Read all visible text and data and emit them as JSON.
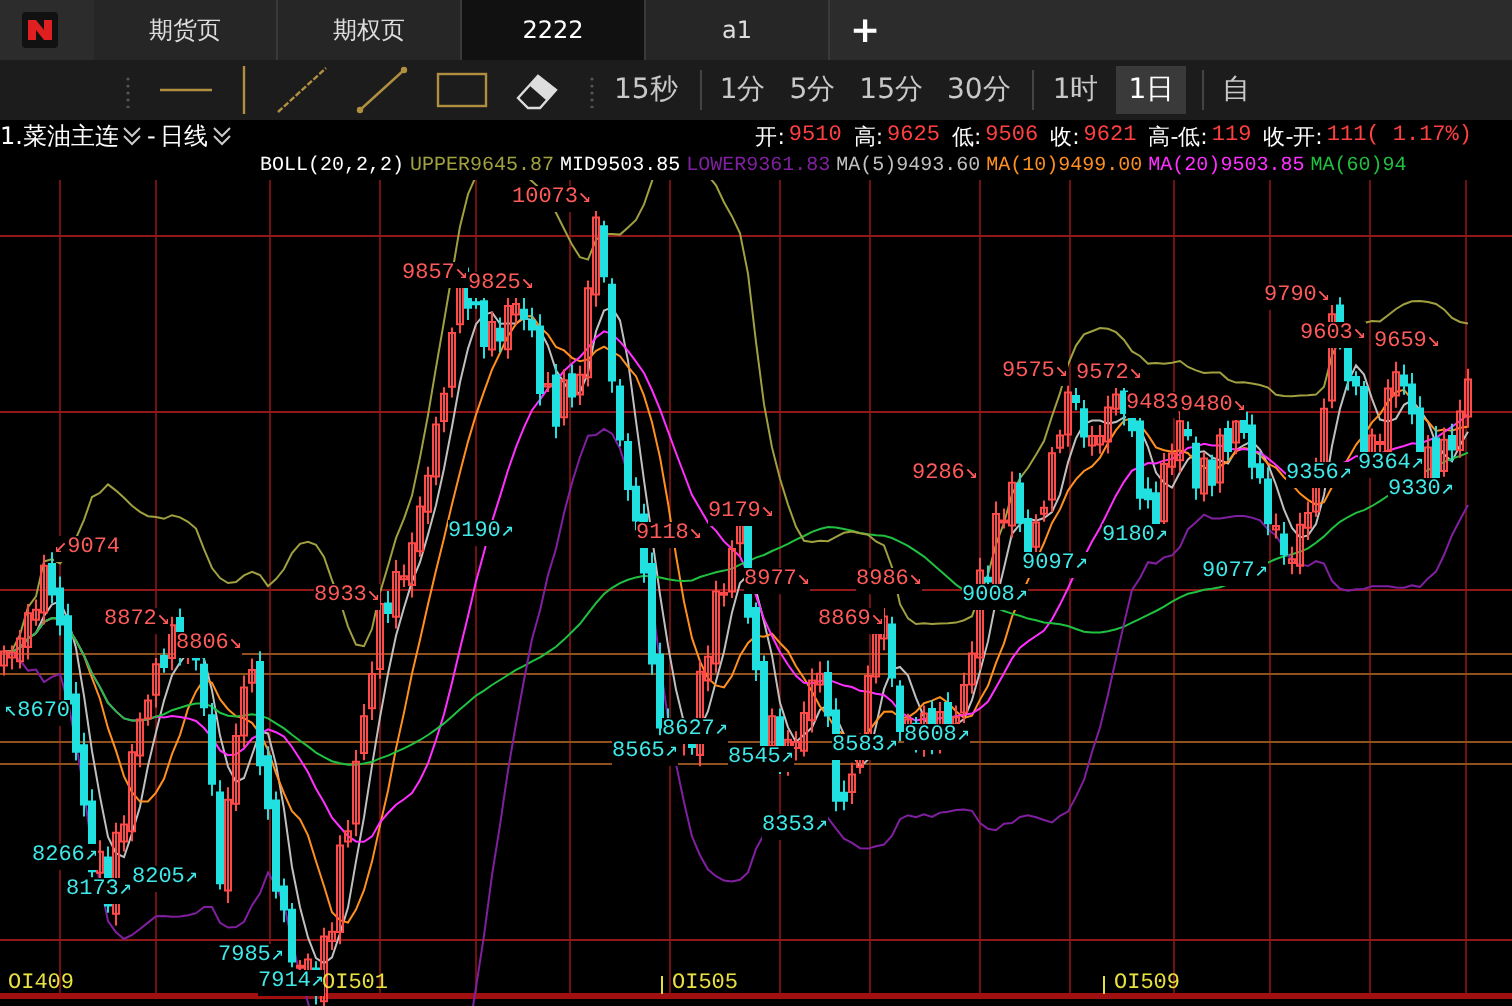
{
  "tabs": [
    {
      "label": "期货页",
      "selected": false
    },
    {
      "label": "期权页",
      "selected": false
    },
    {
      "label": "2222",
      "selected": true
    },
    {
      "label": "a1",
      "selected": false
    }
  ],
  "add_tab": "+",
  "periods": [
    {
      "label": "15秒",
      "selected": false
    },
    {
      "label": "1分",
      "selected": false
    },
    {
      "label": "5分",
      "selected": false
    },
    {
      "label": "15分",
      "selected": false
    },
    {
      "label": "30分",
      "selected": false
    },
    {
      "label": "1时",
      "selected": false
    },
    {
      "label": "1日",
      "selected": true
    },
    {
      "label": "自",
      "selected": false
    }
  ],
  "quote": {
    "symbol": "1.菜油主连",
    "separator": "-",
    "period": "日线",
    "fields": [
      {
        "label": "开:",
        "value": "9510"
      },
      {
        "label": "高:",
        "value": "9625"
      },
      {
        "label": "低:",
        "value": "9506"
      },
      {
        "label": "收:",
        "value": "9621"
      },
      {
        "label": "高-低:",
        "value": "119"
      },
      {
        "label": "收-开:",
        "value": "111( 1.17%)"
      }
    ]
  },
  "indicators": [
    {
      "label": "BOLL(20,2,2)",
      "color": "#ffffff"
    },
    {
      "label": "UPPER",
      "value": "9645.87",
      "color": "#a0a040"
    },
    {
      "label": "MID",
      "value": "9503.85",
      "color": "#ffffff"
    },
    {
      "label": "LOWER",
      "value": "9361.83",
      "color": "#8020a0"
    },
    {
      "label": "MA(5)",
      "value": "9493.60",
      "color": "#c0c0c0"
    },
    {
      "label": "MA(10)",
      "value": "9499.00",
      "color": "#ff9020"
    },
    {
      "label": "MA(20)",
      "value": "9503.85",
      "color": "#ff30ff"
    },
    {
      "label": "MA(60)",
      "value": "94",
      "color": "#20c040"
    }
  ],
  "chart": {
    "annotations": [
      {
        "text": "10073↘",
        "kind": "high"
      },
      {
        "text": "9857↘",
        "kind": "high"
      },
      {
        "text": "9825↘",
        "kind": "high"
      },
      {
        "text": "↙9074",
        "kind": "high"
      },
      {
        "text": "8872↘",
        "kind": "high"
      },
      {
        "text": "8806↘",
        "kind": "high"
      },
      {
        "text": "8933↘",
        "kind": "high"
      },
      {
        "text": "9190↗",
        "kind": "low"
      },
      {
        "text": "9118↘",
        "kind": "high"
      },
      {
        "text": "9179↘",
        "kind": "high"
      },
      {
        "text": "8977↘",
        "kind": "high"
      },
      {
        "text": "8986↘",
        "kind": "high"
      },
      {
        "text": "8869↘",
        "kind": "high"
      },
      {
        "text": "9286↘",
        "kind": "high"
      },
      {
        "text": "9575↘",
        "kind": "high"
      },
      {
        "text": "9572↘",
        "kind": "high"
      },
      {
        "text": "9483",
        "kind": "high"
      },
      {
        "text": "9480↘",
        "kind": "high"
      },
      {
        "text": "9790↘",
        "kind": "high"
      },
      {
        "text": "9603↘",
        "kind": "high"
      },
      {
        "text": "9659↘",
        "kind": "high"
      },
      {
        "text": "9356↗",
        "kind": "low"
      },
      {
        "text": "9364↗",
        "kind": "low"
      },
      {
        "text": "9330↗",
        "kind": "low"
      },
      {
        "text": "9180↗",
        "kind": "low"
      },
      {
        "text": "9097↗",
        "kind": "low"
      },
      {
        "text": "9008↗",
        "kind": "low"
      },
      {
        "text": "9077↗",
        "kind": "low"
      },
      {
        "text": "↖8670",
        "kind": "low"
      },
      {
        "text": "8266↗",
        "kind": "low"
      },
      {
        "text": "8173↗",
        "kind": "low"
      },
      {
        "text": "8205↗",
        "kind": "low"
      },
      {
        "text": "7985↗",
        "kind": "low"
      },
      {
        "text": "7914↗",
        "kind": "low"
      },
      {
        "text": "8627↗",
        "kind": "low"
      },
      {
        "text": "8565↗",
        "kind": "low"
      },
      {
        "text": "8545↗",
        "kind": "low"
      },
      {
        "text": "8583↗",
        "kind": "low"
      },
      {
        "text": "8608↗",
        "kind": "low"
      },
      {
        "text": "8353↗",
        "kind": "low"
      }
    ],
    "x_labels": [
      "OI409",
      "OI501",
      "OI505",
      "OI509"
    ]
  }
}
